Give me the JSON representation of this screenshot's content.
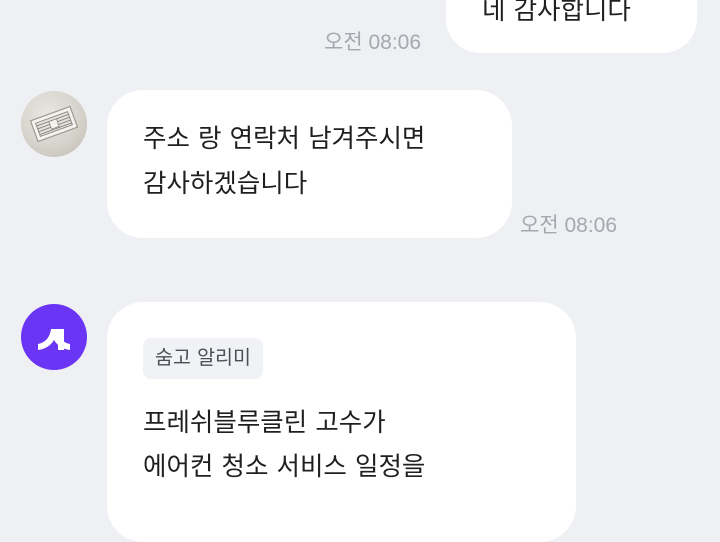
{
  "messages": {
    "outgoing": {
      "text": "네 감사합니다",
      "time": "오전 08:06"
    },
    "incoming_1": {
      "text": "주소 랑 연락처 남겨주시면\n감사하겠습니다",
      "time": "오전 08:06",
      "avatar_icon": "air-conditioner-photo-icon"
    },
    "incoming_2": {
      "tag": "숨고 알리미",
      "text": "프레쉬블루클린 고수가\n에어컨 청소 서비스 일정을",
      "avatar_icon": "soomgo-logo-icon"
    }
  },
  "colors": {
    "background": "#eff0f3",
    "bubble": "#ffffff",
    "timestamp": "#a5a8ae",
    "brand": "#6a35f5"
  }
}
